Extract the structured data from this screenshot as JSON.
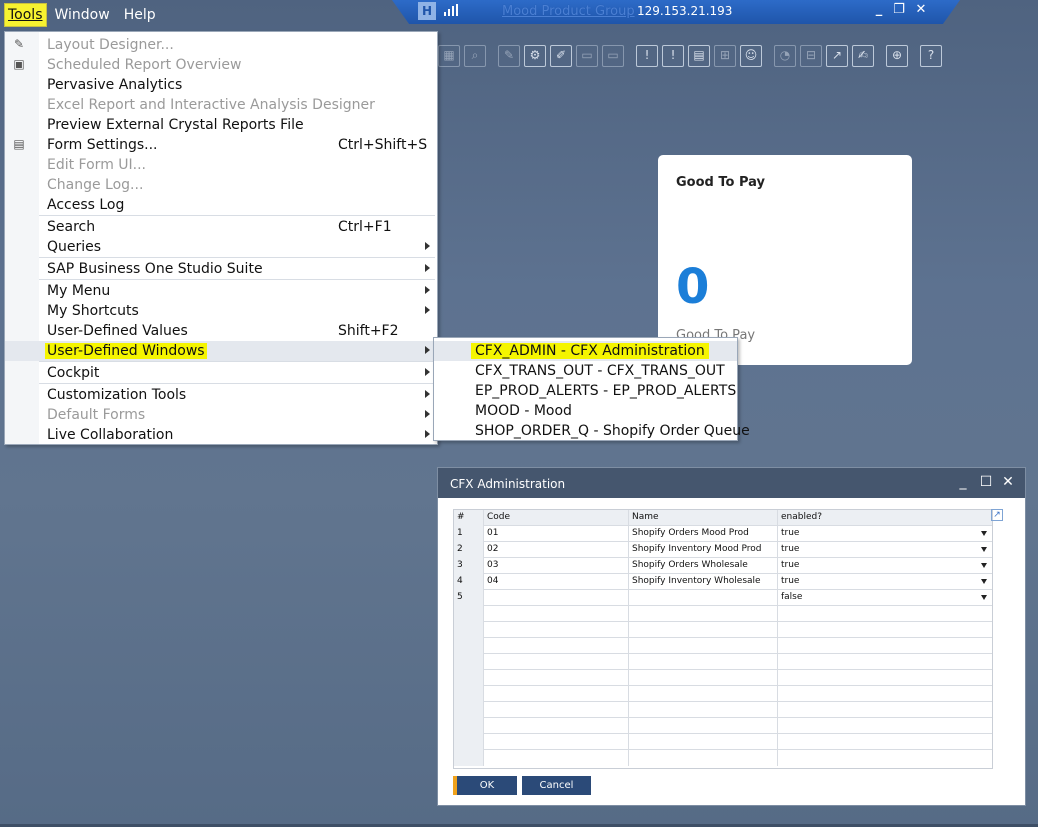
{
  "menubar": {
    "tools": "Tools",
    "window": "Window",
    "help": "Help"
  },
  "titlebar": {
    "company": "Mood Product Group",
    "ip": "129.153.21.193",
    "minimize": "_",
    "restore": "❐",
    "close": "✕"
  },
  "tools_menu": {
    "layout_designer": "Layout Designer...",
    "scheduled_report": "Scheduled Report Overview",
    "pervasive": "Pervasive Analytics",
    "excel_report": "Excel Report and Interactive Analysis Designer",
    "preview_crystal": "Preview External Crystal Reports File",
    "form_settings": "Form Settings...",
    "form_settings_accel": "Ctrl+Shift+S",
    "edit_form_ui": "Edit Form UI...",
    "change_log": "Change Log...",
    "access_log": "Access Log",
    "search": "Search",
    "search_accel": "Ctrl+F1",
    "queries": "Queries",
    "studio_suite": "SAP Business One Studio Suite",
    "my_menu": "My Menu",
    "my_shortcuts": "My Shortcuts",
    "udv": "User-Defined Values",
    "udv_accel": "Shift+F2",
    "udw": "User-Defined Windows",
    "cockpit": "Cockpit",
    "customization": "Customization Tools",
    "default_forms": "Default Forms",
    "live_collab": "Live Collaboration"
  },
  "submenu": {
    "items": [
      "CFX_ADMIN - CFX Administration",
      "CFX_TRANS_OUT - CFX_TRANS_OUT",
      "EP_PROD_ALERTS - EP_PROD_ALERTS",
      "MOOD - Mood",
      "SHOP_ORDER_Q - Shopify Order Queue"
    ]
  },
  "tile": {
    "title": "Good To Pay",
    "value": "0",
    "subtitle": "Good To Pay"
  },
  "cfx": {
    "title": "CFX Administration",
    "columns": [
      "#",
      "Code",
      "Name",
      "enabled?"
    ],
    "rows": [
      [
        "1",
        "01",
        "Shopify Orders Mood Prod",
        "true"
      ],
      [
        "2",
        "02",
        "Shopify Inventory Mood Prod",
        "true"
      ],
      [
        "3",
        "03",
        "Shopify Orders Wholesale",
        "true"
      ],
      [
        "4",
        "04",
        "Shopify Inventory Wholesale",
        "true"
      ],
      [
        "5",
        "",
        "",
        "false"
      ]
    ],
    "ok": "OK",
    "cancel": "Cancel"
  }
}
